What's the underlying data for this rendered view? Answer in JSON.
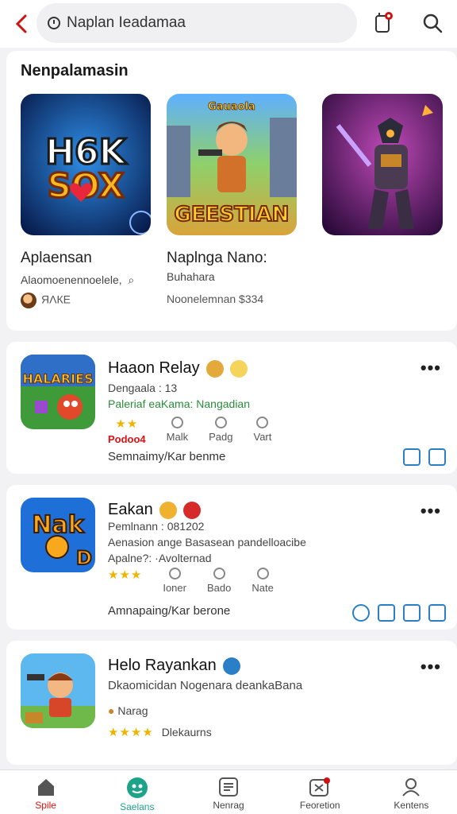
{
  "header": {
    "search_text": "Naplan Ieadamaa"
  },
  "featured": {
    "title": "Nenpalamasin",
    "items": [
      {
        "name": "Aplaensan",
        "sub": "Alaomoenennoelele,  ⌕",
        "meta": "ЯΛКЕ"
      },
      {
        "name": "Naplnga Nano:",
        "sub": "Buhahara",
        "meta": "Noonelemnan $334"
      },
      {
        "name": "",
        "sub": "",
        "meta": ""
      }
    ]
  },
  "list": [
    {
      "title": "Haaon Relay",
      "line1": "Dengaala : 13",
      "line2": "Paleriaf eaKama: Nangadian",
      "icons": [
        "Podoo4",
        "Malk",
        "Padg",
        "Vart"
      ],
      "bottom": "Semnaimy/Kar benme"
    },
    {
      "title": "Eakan",
      "line1": "Pemlnann : 081202",
      "line2": "Aenasion ange Basasean pandelloacibe",
      "line3": "Apalne?: ·Avolternad",
      "icons": [
        "Ioner",
        "Bado",
        "Nate"
      ],
      "bottom": "Amnapaing/Kar berone"
    },
    {
      "title": "Helo Rayankan",
      "line1": "Dkaomicidan Nogenara deankaBana",
      "line2": "Narag",
      "line3": "Dlekaurns"
    }
  ],
  "nav": [
    {
      "label": "Spile"
    },
    {
      "label": "Saelans"
    },
    {
      "label": "Nenrag"
    },
    {
      "label": "Feoretion"
    },
    {
      "label": "Kentens"
    }
  ],
  "colors": {
    "accent_red": "#d11111",
    "active_teal": "#1da38a",
    "action_blue": "#2a7fc7",
    "star": "#f0b400"
  }
}
